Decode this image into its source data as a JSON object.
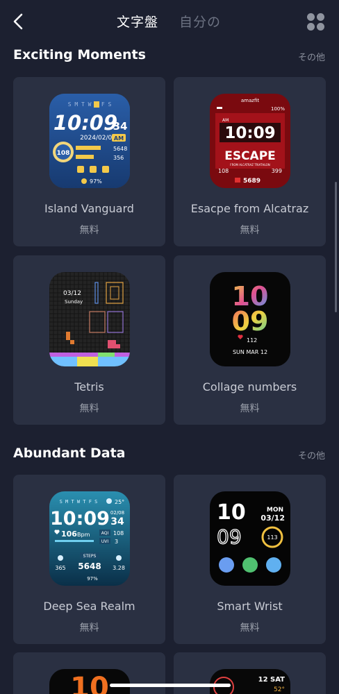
{
  "header": {
    "tabs": [
      {
        "label": "文字盤",
        "active": true
      },
      {
        "label": "自分の",
        "active": false
      }
    ]
  },
  "sections": [
    {
      "title": "Exciting Moments",
      "more": "その他",
      "cards": [
        {
          "name": "Island Vanguard",
          "price": "無料",
          "face": {
            "days": "S M T W T F S",
            "time": "10:09",
            "seconds": "34",
            "date": "2024/02/08",
            "ampm": "AM",
            "ring": "108",
            "steps": "5648",
            "cal": "356",
            "battery": "97%"
          }
        },
        {
          "name": "Esacpe from Alcatraz",
          "price": "無料",
          "face": {
            "brand": "amazfit",
            "battery": "100%",
            "ampm": "AM",
            "time": "10:09",
            "title": "ESCAPE",
            "subtitle": "FROM ALCATRAZ TRIATHLON",
            "left": "108",
            "right": "399",
            "steps": "5689"
          }
        },
        {
          "name": "Tetris",
          "price": "無料",
          "face": {
            "date": "03/12",
            "day": "Sunday"
          }
        },
        {
          "name": "Collage numbers",
          "price": "無料",
          "face": {
            "hour": "10",
            "minute": "09",
            "heart": "112",
            "date": "SUN MAR 12"
          }
        }
      ]
    },
    {
      "title": "Abundant Data",
      "more": "その他",
      "cards": [
        {
          "name": "Deep Sea Realm",
          "price": "無料",
          "face": {
            "days": "S M T W T F S",
            "temp": "25°",
            "time": "10:09",
            "date": "02/08",
            "seconds": "34",
            "bpm": "106",
            "bpm_unit": "Bpm",
            "aqi_label": "AQI",
            "aqi": "108",
            "uvi_label": "UVI",
            "uvi": "3",
            "left": "365",
            "steps_label": "STEPS",
            "steps": "5648",
            "right": "3.28",
            "battery": "97%"
          }
        },
        {
          "name": "Smart Wrist",
          "price": "無料",
          "face": {
            "hour": "10",
            "minute": "09",
            "dow": "MON",
            "date": "03/12",
            "ring": "113"
          }
        }
      ]
    }
  ],
  "partial": {
    "left_digits": "10",
    "right_date": "12 SAT",
    "right_temp": "52°"
  },
  "colors": {
    "background": "#1c2030",
    "card": "#2a3042"
  }
}
